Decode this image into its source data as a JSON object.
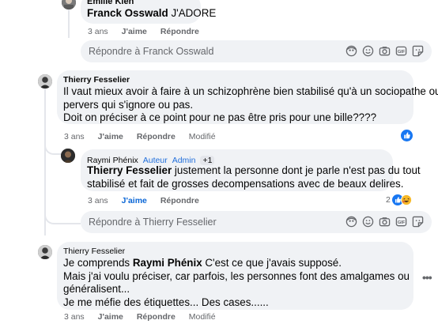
{
  "comments": [
    {
      "author": "Emilie Kien",
      "mention": "Franck Osswald",
      "text": " J'ADORE",
      "time": "3 ans",
      "like_label": "J'aime",
      "reply_label": "Répondre"
    },
    {
      "author": "Thierry Fesselier",
      "lines": [
        "Il vaut mieux avoir à faire à un schizophrène bien stabilisé qu'à un sociopathe ou",
        "pervers qui s'ignore ou pas.",
        "Doit on préciser à ce point pour ne pas être pris pour une bille????"
      ],
      "time": "3 ans",
      "like_label": "J'aime",
      "reply_label": "Répondre",
      "edited": "Modifié"
    },
    {
      "author": "Raymi Phénix",
      "badges": [
        "Auteur",
        "Admin"
      ],
      "extra": "+1",
      "mention": "Thierry Fesselier",
      "line1": " justement la personne dont je parle n'est pas du tout",
      "line2": "stabilisé et fait de grosses decompensations avec de beaux delires.",
      "time": "3 ans",
      "like_label": "J'aime",
      "reply_label": "Répondre",
      "reaction_count": "2"
    },
    {
      "author": "Thierry Fesselier",
      "line1_a": "Je comprends ",
      "mention": "Raymi Phénix",
      "line1_b": " C'est ce que j'avais supposé.",
      "line2": "Mais j'ai voulu préciser, car parfois, les personnes font des amalgames ou",
      "line3": "généralisent...",
      "line4": "Je me méfie des étiquettes... Des cases......",
      "time": "3 ans",
      "like_label": "J'aime",
      "reply_label": "Répondre",
      "edited": "Modifié"
    }
  ],
  "reply_boxes": [
    {
      "placeholder": "Répondre à Franck Osswald"
    },
    {
      "placeholder": "Répondre à Thierry Fesselier"
    }
  ],
  "icons": [
    "avatar-sticker-icon",
    "emoji-icon",
    "camera-icon",
    "gif-icon",
    "sticker-icon",
    "more-icon",
    "like-reaction-icon",
    "haha-reaction-icon"
  ],
  "colors": {
    "bubble": "#f0f2f5",
    "link_blue": "#216fdb",
    "muted": "#65676b",
    "like_blue": "#0a66d6"
  }
}
